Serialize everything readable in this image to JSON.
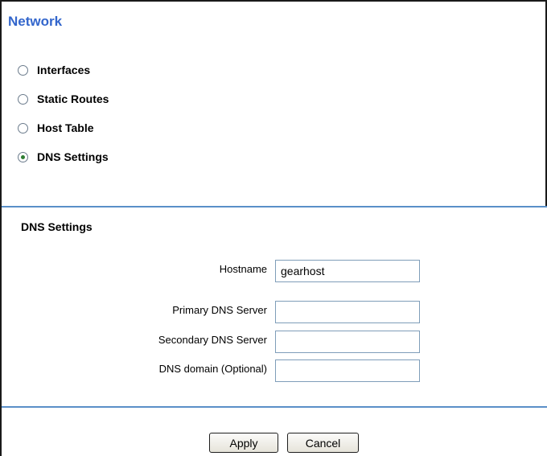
{
  "header": {
    "title": "Network"
  },
  "nav": {
    "options": [
      {
        "label": "Interfaces",
        "selected": false
      },
      {
        "label": "Static Routes",
        "selected": false
      },
      {
        "label": "Host Table",
        "selected": false
      },
      {
        "label": "DNS Settings",
        "selected": true
      }
    ]
  },
  "dns": {
    "section_title": "DNS Settings",
    "hostname": {
      "label": "Hostname",
      "value": "gearhost"
    },
    "primary": {
      "label": "Primary DNS Server",
      "value": ""
    },
    "secondary": {
      "label": "Secondary DNS Server",
      "value": ""
    },
    "domain": {
      "label": "DNS domain (Optional)",
      "value": ""
    }
  },
  "actions": {
    "apply_label": "Apply",
    "cancel_label": "Cancel"
  },
  "colors": {
    "title": "#3366cc",
    "divider": "#5a8fc8",
    "radio_selected": "#2e7d32"
  }
}
